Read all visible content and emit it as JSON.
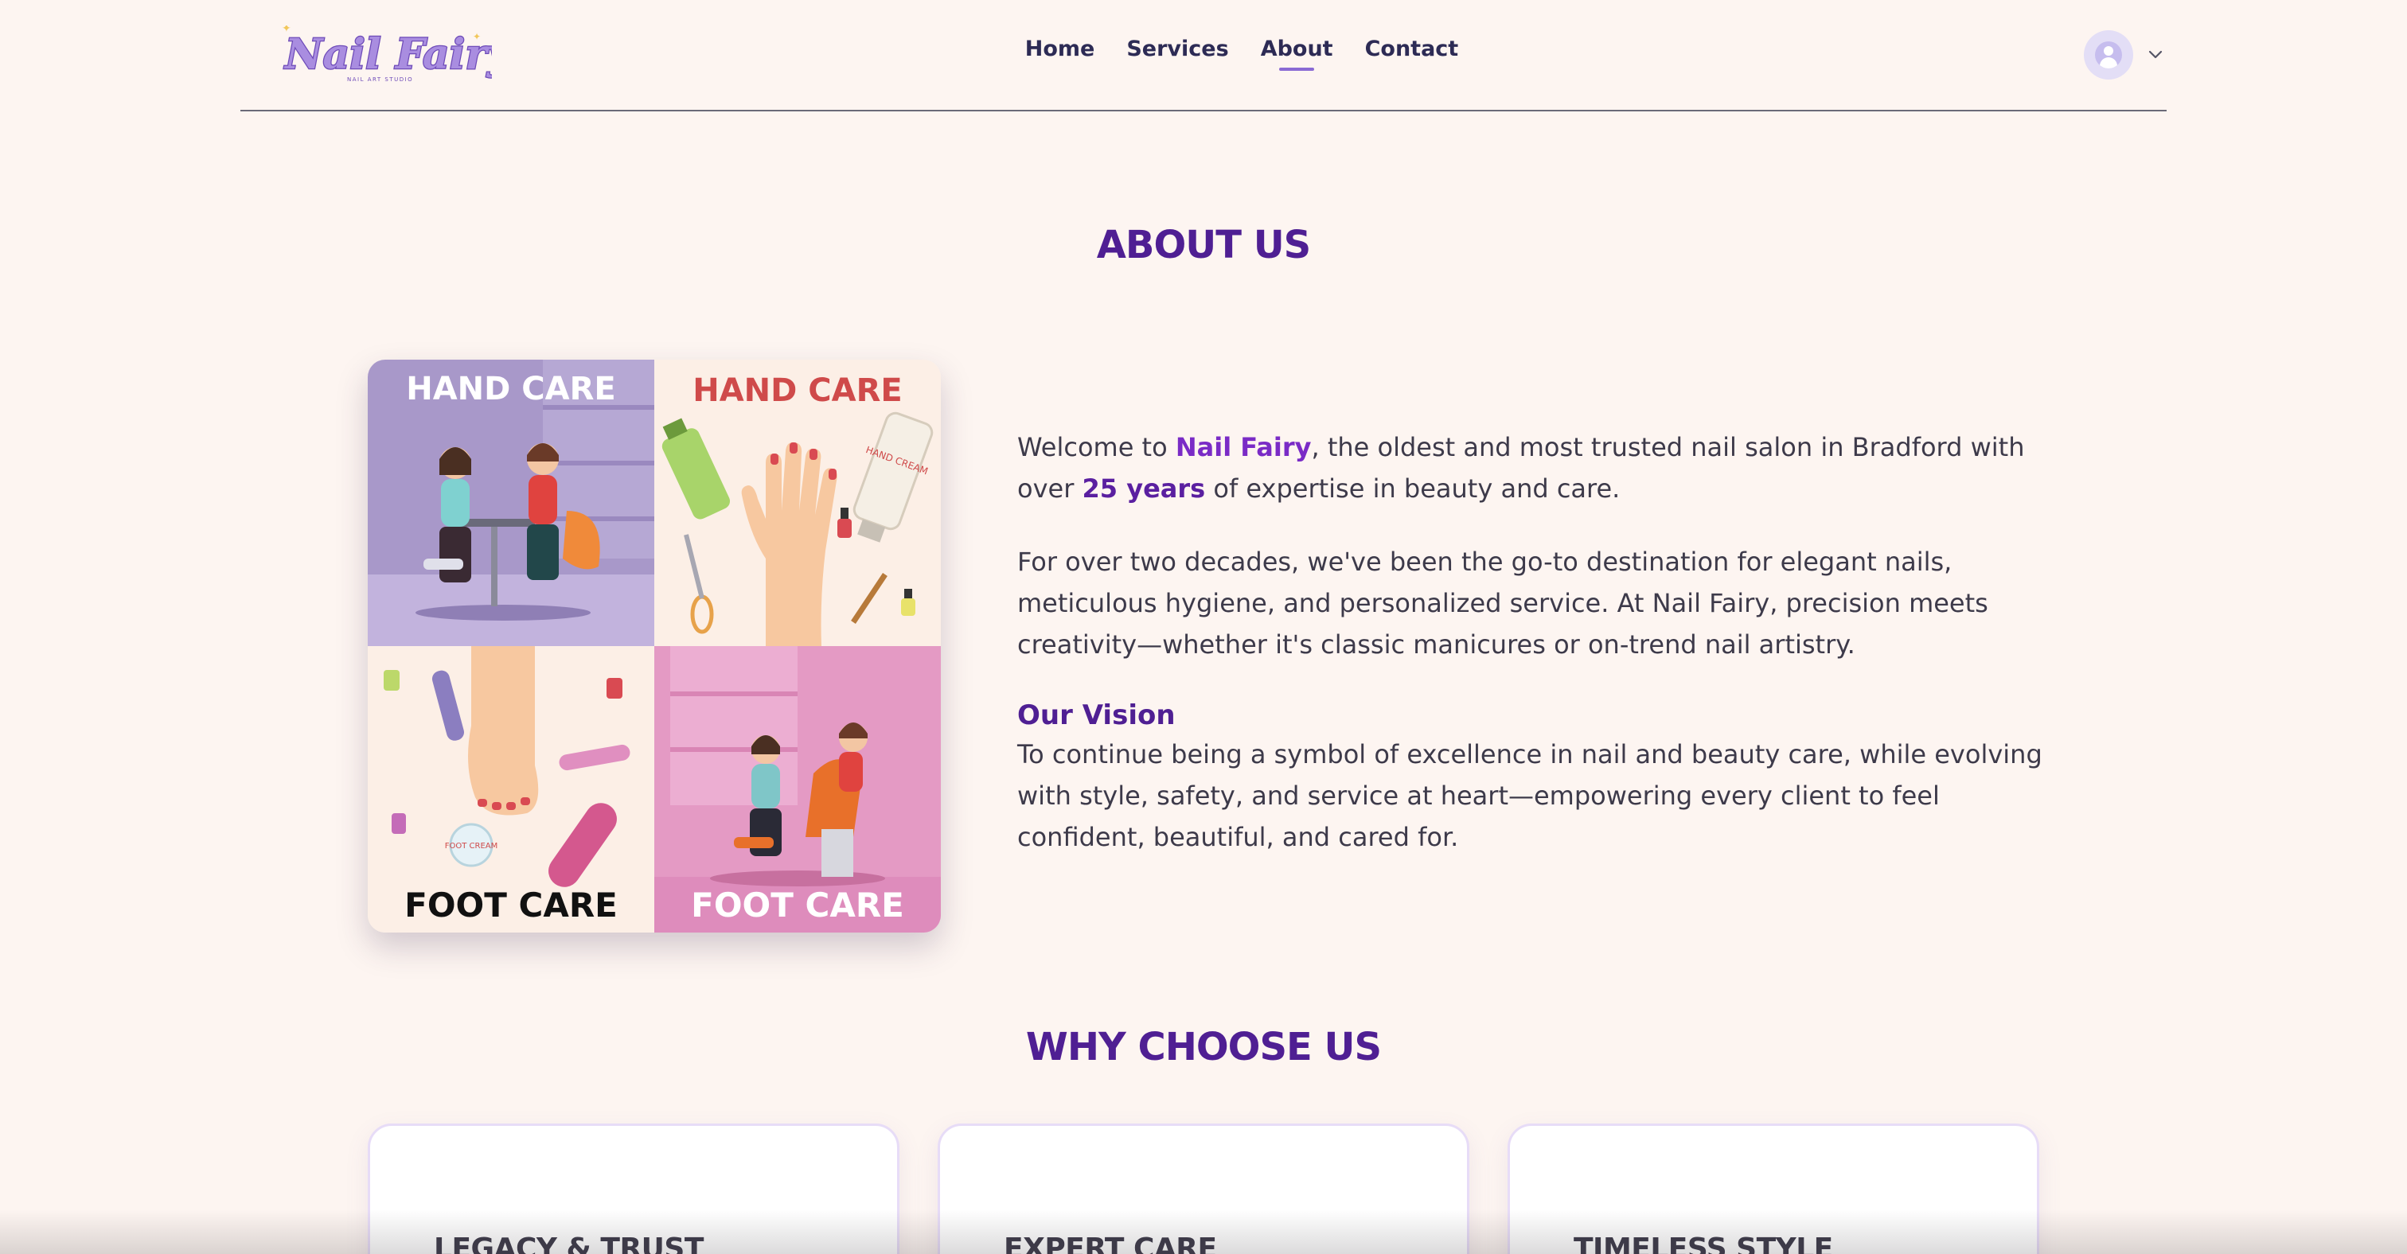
{
  "brand": {
    "logo_text": "Nail Fairy",
    "logo_tagline": "NAIL ART STUDIO"
  },
  "nav": {
    "items": [
      {
        "label": "Home",
        "active": false
      },
      {
        "label": "Services",
        "active": false
      },
      {
        "label": "About",
        "active": true
      },
      {
        "label": "Contact",
        "active": false
      }
    ]
  },
  "user_menu": {
    "avatar_icon": "user-avatar-icon",
    "dropdown_icon": "chevron-down-icon"
  },
  "about": {
    "title": "ABOUT US",
    "collage": {
      "panels": [
        "HAND CARE",
        "HAND CARE",
        "FOOT CARE",
        "FOOT CARE"
      ],
      "hand_cream_label": "HAND CREAM",
      "foot_cream_label": "FOOT CREAM"
    },
    "intro": {
      "part1": "Welcome to ",
      "brand": "Nail Fairy",
      "part2": ", the oldest and most trusted nail salon in Bradford with over ",
      "years": "25 years",
      "part3": " of expertise in beauty and care."
    },
    "paragraph2": "For over two decades, we've been the go-to destination for elegant nails, meticulous hygiene, and personalized service. At Nail Fairy, precision meets creativity—whether it's classic manicures or on-trend nail artistry.",
    "vision_title": "Our Vision",
    "vision_text": "To continue being a symbol of excellence in nail and beauty care, while evolving with style, safety, and service at heart—empowering every client to feel confident, beautiful, and cared for."
  },
  "why": {
    "title": "WHY CHOOSE US",
    "cards": [
      {
        "title": "LEGACY & TRUST"
      },
      {
        "title": "EXPERT CARE"
      },
      {
        "title": "TIMELESS STYLE"
      }
    ]
  },
  "colors": {
    "background": "#fdf5f1",
    "heading": "#4f1f93",
    "accent": "#7a2bc6",
    "nav_text": "#2d2b55"
  }
}
